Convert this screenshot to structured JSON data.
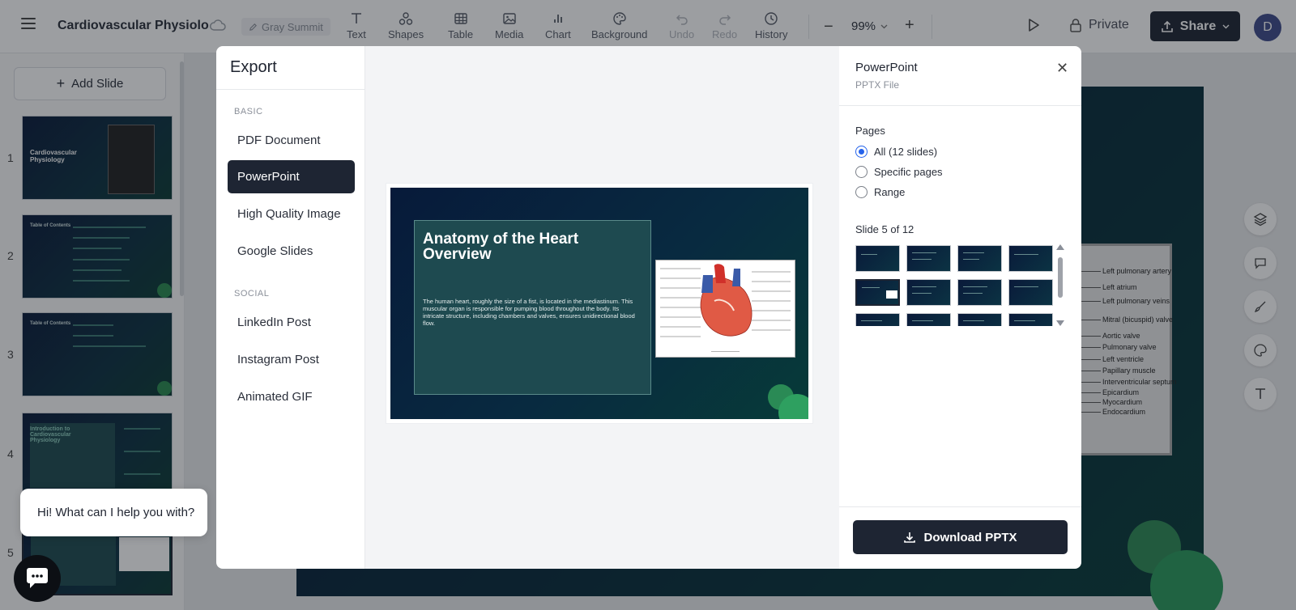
{
  "app": {
    "doc_title": "Cardiovascular Physiolo",
    "workspace": "Gray Summit"
  },
  "toolbar": {
    "tools": [
      {
        "label": "Text",
        "icon": "text-icon",
        "enabled": true
      },
      {
        "label": "Shapes",
        "icon": "shapes-icon",
        "enabled": true
      },
      {
        "label": "Table",
        "icon": "table-icon",
        "enabled": true
      },
      {
        "label": "Media",
        "icon": "image-icon",
        "enabled": true
      },
      {
        "label": "Chart",
        "icon": "chart-icon",
        "enabled": true
      },
      {
        "label": "Background",
        "icon": "palette-icon",
        "enabled": true
      },
      {
        "label": "Undo",
        "icon": "undo-icon",
        "enabled": false
      },
      {
        "label": "Redo",
        "icon": "redo-icon",
        "enabled": false
      },
      {
        "label": "History",
        "icon": "clock-icon",
        "enabled": true
      }
    ],
    "zoom": "99%",
    "private_label": "Private",
    "share_label": "Share",
    "avatar_initial": "D"
  },
  "slides_panel": {
    "add_slide_label": "Add Slide",
    "slide_numbers": [
      "1",
      "2",
      "3",
      "4",
      "5"
    ],
    "selected_index": 5
  },
  "canvas": {
    "diagram_labels": [
      "Left pulmonary artery",
      "Left atrium",
      "Left pulmonary veins",
      "Mitral (bicuspid) valve",
      "Aortic valve",
      "Pulmonary valve",
      "Left ventricle",
      "Papillary muscle",
      "Interventricular septum",
      "Epicardium",
      "Myocardium",
      "Endocardium"
    ]
  },
  "export_modal": {
    "title": "Export",
    "basic_label": "BASIC",
    "social_label": "SOCIAL",
    "basic_formats": [
      "PDF Document",
      "PowerPoint",
      "High Quality Image",
      "Google Slides"
    ],
    "social_formats": [
      "LinkedIn Post",
      "Instagram Post",
      "Animated GIF"
    ],
    "selected_format": "PowerPoint",
    "preview": {
      "slide_title": "Anatomy of the Heart Overview",
      "slide_body": "The human heart, roughly the size of a fist, is located in the mediastinum. This muscular organ is responsible for pumping blood throughout the body. Its intricate structure, including chambers and valves, ensures unidirectional blood flow."
    },
    "options": {
      "format_title": "PowerPoint",
      "format_subtitle": "PPTX File",
      "pages_label": "Pages",
      "page_options": [
        "All (12 slides)",
        "Specific pages",
        "Range"
      ],
      "selected_page_option": 0,
      "slide_indicator": "Slide 5 of 12",
      "download_label": "Download PPTX"
    }
  },
  "chat": {
    "greeting": "Hi! What can I help you with?"
  },
  "colors": {
    "primary_dark": "#1e2533",
    "accent_blue": "#2563eb",
    "slide_bg": "#071a3a",
    "slide_green": "#2a8a55"
  }
}
